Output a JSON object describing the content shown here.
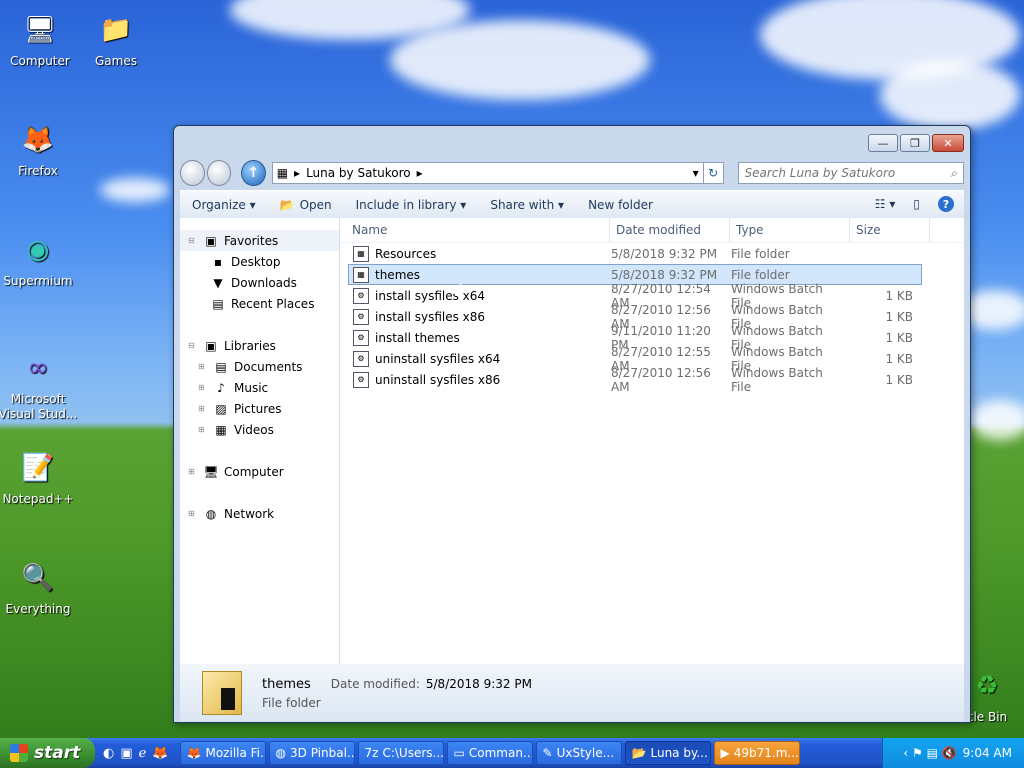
{
  "desktop": {
    "icons": [
      {
        "label": "Computer",
        "icon": "computer-icon",
        "glyph": "🖥"
      },
      {
        "label": "Games",
        "icon": "folder-icon",
        "glyph": "📁"
      },
      {
        "label": "Firefox",
        "icon": "firefox-icon",
        "glyph": "🦊"
      },
      {
        "label": "Supermium",
        "icon": "supermium-icon",
        "glyph": "◉"
      },
      {
        "label": "Microsoft Visual Stud...",
        "icon": "visual-studio-icon",
        "glyph": "∞"
      },
      {
        "label": "Notepad++",
        "icon": "notepadpp-icon",
        "glyph": "📝"
      },
      {
        "label": "Everything",
        "icon": "everything-search-icon",
        "glyph": "🔍"
      },
      {
        "label": "cle Bin",
        "icon": "recycle-bin-icon",
        "glyph": "♻"
      }
    ]
  },
  "window": {
    "caption": {
      "minimize": "—",
      "maximize": "❐",
      "close": "✕"
    },
    "address": {
      "root_icon": "▦",
      "sep": "▸",
      "path": "Luna by Satukoro",
      "dropdown": "▾",
      "refresh": "↻"
    },
    "search": {
      "placeholder": "Search Luna by Satukoro",
      "icon": "⌕"
    },
    "toolbar": {
      "organize": "Organize ▾",
      "open": "Open",
      "include_in_library": "Include in library ▾",
      "share_with": "Share with ▾",
      "new_folder": "New folder",
      "views": "☷ ▾",
      "preview": "▯",
      "help": "?"
    },
    "nav": {
      "favorites": "Favorites",
      "desktop": "Desktop",
      "downloads": "Downloads",
      "recent_places": "Recent Places",
      "libraries": "Libraries",
      "documents": "Documents",
      "music": "Music",
      "pictures": "Pictures",
      "videos": "Videos",
      "computer": "Computer",
      "network": "Network"
    },
    "columns": {
      "name": "Name",
      "date_modified": "Date modified",
      "type": "Type",
      "size": "Size"
    },
    "files": [
      {
        "name": "Resources",
        "date": "5/8/2018 9:32 PM",
        "type": "File folder",
        "size": ""
      },
      {
        "name": "themes",
        "date": "5/8/2018 9:32 PM",
        "type": "File folder",
        "size": ""
      },
      {
        "name": "install sysfiles x64",
        "date": "8/27/2010 12:54 AM",
        "type": "Windows Batch File",
        "size": "1 KB"
      },
      {
        "name": "install sysfiles x86",
        "date": "8/27/2010 12:56 AM",
        "type": "Windows Batch File",
        "size": "1 KB"
      },
      {
        "name": "install themes",
        "date": "9/11/2010 11:20 PM",
        "type": "Windows Batch File",
        "size": "1 KB"
      },
      {
        "name": "uninstall sysfiles x64",
        "date": "8/27/2010 12:55 AM",
        "type": "Windows Batch File",
        "size": "1 KB"
      },
      {
        "name": "uninstall sysfiles x86",
        "date": "8/27/2010 12:56 AM",
        "type": "Windows Batch File",
        "size": "1 KB"
      }
    ],
    "selected_index": 1,
    "details": {
      "name": "themes",
      "date_label": "Date modified:",
      "date_value": "5/8/2018 9:32 PM",
      "type": "File folder"
    }
  },
  "taskbar": {
    "start": "start",
    "quick_launch": [
      "◐",
      "▣",
      "ℯ",
      "🦊"
    ],
    "buttons": [
      {
        "label": "Mozilla Fi...",
        "icon": "firefox-icon",
        "glyph": "🦊",
        "state": "normal"
      },
      {
        "label": "3D Pinbal...",
        "icon": "pinball-icon",
        "glyph": "◍",
        "state": "normal"
      },
      {
        "label": "C:\\Users...",
        "icon": "7zip-icon",
        "glyph": "7z",
        "state": "normal"
      },
      {
        "label": "Comman...",
        "icon": "cmd-icon",
        "glyph": "▭",
        "state": "normal"
      },
      {
        "label": "UxStyle...",
        "icon": "uxstyle-icon",
        "glyph": "✎",
        "state": "normal"
      },
      {
        "label": "Luna by...",
        "icon": "folder-icon",
        "glyph": "📂",
        "state": "active"
      },
      {
        "label": "49b71.m...",
        "icon": "video-icon",
        "glyph": "▶",
        "state": "flash"
      }
    ],
    "tray": {
      "icons": "‹ ⚑ ▤ 🔇",
      "time": "9:04 AM"
    }
  }
}
